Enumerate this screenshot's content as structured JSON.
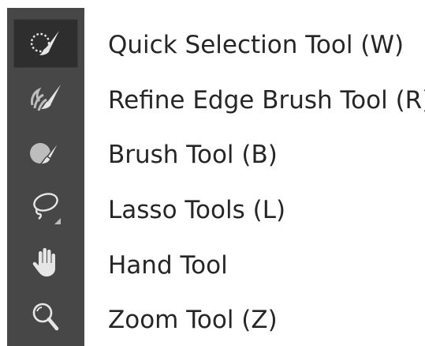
{
  "tools": [
    {
      "label": "Quick Selection Tool (W)",
      "icon": "quick-selection-icon",
      "active": true
    },
    {
      "label": "Refine Edge Brush Tool (R)",
      "icon": "refine-edge-brush-icon",
      "active": false
    },
    {
      "label": "Brush Tool (B)",
      "icon": "brush-icon",
      "active": false
    },
    {
      "label": "Lasso Tools (L)",
      "icon": "lasso-icon",
      "active": false
    },
    {
      "label": "Hand Tool",
      "icon": "hand-icon",
      "active": false
    },
    {
      "label": "Zoom Tool (Z)",
      "icon": "zoom-icon",
      "active": false
    }
  ],
  "colors": {
    "toolbar_bg": "#474747",
    "active_bg": "#2e2e2e",
    "icon_light": "#e6e6e6",
    "icon_dim": "#bdbdbd",
    "label_text": "#262626"
  }
}
